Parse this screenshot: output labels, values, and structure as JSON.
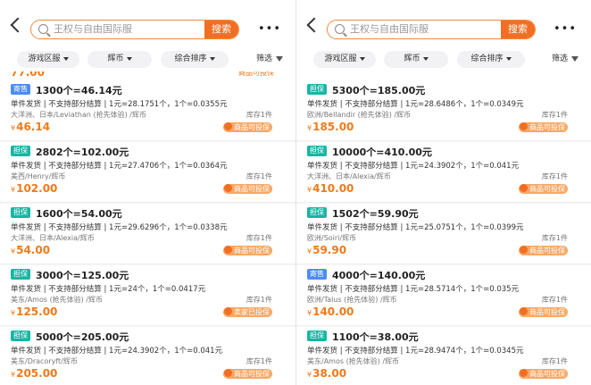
{
  "panels": [
    {
      "search": {
        "placeholder": "王权与自由国际服",
        "button": "搜索"
      },
      "filters": {
        "region": "游戏区服",
        "currency": "辉币",
        "sort": "综合排序",
        "filter": "筛选"
      },
      "partial_top": {
        "price": "77.00",
        "tag": "商品可投保"
      },
      "listings": [
        {
          "badge": "寄售",
          "badge_color": "#4c8cf5",
          "title": "1300个=46.14元",
          "desc": "单件发货 | 不支持部分结算 | 1元=28.1751个，1个=0.0355元",
          "region": "大洋洲、日本/Leviathan (抢先体验) /辉币",
          "stock": "库存1件",
          "currency_symbol": "¥",
          "price": "46.14",
          "tag": "商品可投保"
        },
        {
          "badge": "担保",
          "badge_color": "#18b5a3",
          "title": "2802个=102.00元",
          "desc": "单件发货 | 不支持部分结算 | 1元=27.4706个，1个=0.0364元",
          "region": "美西/Henry/辉币",
          "stock": "库存1件",
          "currency_symbol": "¥",
          "price": "102.00",
          "tag": "商品可投保"
        },
        {
          "badge": "担保",
          "badge_color": "#18b5a3",
          "title": "1600个=54.00元",
          "desc": "单件发货 | 不支持部分结算 | 1元=29.6296个，1个=0.0338元",
          "region": "大洋洲、日本/Alexia/辉币",
          "stock": "库存1件",
          "currency_symbol": "¥",
          "price": "54.00",
          "tag": "商品可投保"
        },
        {
          "badge": "担保",
          "badge_color": "#18b5a3",
          "title": "3000个=125.00元",
          "desc": "单件发货 | 不支持部分结算 | 1元=24个，1个=0.0417元",
          "region": "美东/Amos (抢先体验) /辉币",
          "stock": "库存1件",
          "currency_symbol": "¥",
          "price": "125.00",
          "tag": "卖家已投保"
        },
        {
          "badge": "担保",
          "badge_color": "#18b5a3",
          "title": "5000个=205.00元",
          "desc": "单件发货 | 不支持部分结算 | 1元=24.3902个，1个=0.041元",
          "region": "美东/Dracoryft/辉币",
          "stock": "库存1件",
          "currency_symbol": "¥",
          "price": "205.00",
          "tag": "商品可投保"
        }
      ]
    },
    {
      "search": {
        "placeholder": "王权与自由国际服",
        "button": "搜索"
      },
      "filters": {
        "region": "游戏区服",
        "currency": "辉币",
        "sort": "综合排序",
        "filter": "筛选"
      },
      "partial_top": {
        "price": "",
        "tag": ""
      },
      "listings": [
        {
          "badge": "担保",
          "badge_color": "#18b5a3",
          "title": "5300个=185.00元",
          "desc": "单件发货 | 不支持部分结算 | 1元=28.6486个，1个=0.0349元",
          "region": "欧洲/Bellandir (抢先体验) /辉币",
          "stock": "库存1件",
          "currency_symbol": "¥",
          "price": "185.00",
          "tag": "商品可投保"
        },
        {
          "badge": "担保",
          "badge_color": "#18b5a3",
          "title": "10000个=410.00元",
          "desc": "单件发货 | 不支持部分结算 | 1元=24.3902个，1个=0.041元",
          "region": "大洋洲、日本/Alexia/辉币",
          "stock": "库存1件",
          "currency_symbol": "¥",
          "price": "410.00",
          "tag": "商品可投保"
        },
        {
          "badge": "担保",
          "badge_color": "#18b5a3",
          "title": "1502个=59.90元",
          "desc": "单件发货 | 不支持部分结算 | 1元=25.0751个，1个=0.0399元",
          "region": "欧洲/Soiri/辉币",
          "stock": "库存1件",
          "currency_symbol": "¥",
          "price": "59.90",
          "tag": "商品可投保"
        },
        {
          "badge": "寄售",
          "badge_color": "#4c8cf5",
          "title": "4000个=140.00元",
          "desc": "单件发货 | 不支持部分结算 | 1元=28.5714个，1个=0.035元",
          "region": "欧洲/Talus (抢先体验) /辉币",
          "stock": "库存1件",
          "currency_symbol": "¥",
          "price": "140.00",
          "tag": "商品可投保"
        },
        {
          "badge": "担保",
          "badge_color": "#18b5a3",
          "title": "1100个=38.00元",
          "desc": "单件发货 | 不支持部分结算 | 1元=28.9474个，1个=0.0345元",
          "region": "美东/Amos (抢先体验) /辉币",
          "stock": "库存1件",
          "currency_symbol": "¥",
          "price": "38.00",
          "tag": "商品可投保"
        }
      ]
    }
  ]
}
